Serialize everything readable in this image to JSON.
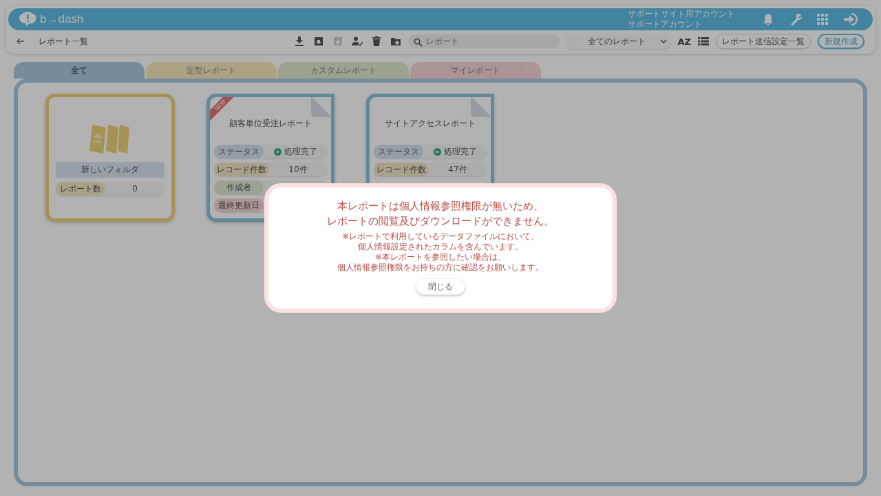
{
  "header": {
    "logo": "b→dash",
    "account_site": "サポートサイト用アカウント",
    "account_name": "サポートアカウント"
  },
  "toolbar": {
    "back_label": "レポート一覧",
    "tools": [
      {
        "kind": "download",
        "disabled": false
      },
      {
        "kind": "archive-down",
        "disabled": false
      },
      {
        "kind": "archive-up",
        "disabled": true
      },
      {
        "kind": "user-check",
        "disabled": false
      },
      {
        "kind": "trash",
        "disabled": false
      },
      {
        "kind": "folder-plus",
        "disabled": false
      }
    ],
    "search": {
      "placeholder": "レポート"
    },
    "filter": "全てのレポート",
    "sort_label": "AZ",
    "send_settings": "レポート送信設定一覧",
    "create": "新規作成"
  },
  "tabs": [
    {
      "label": "全て",
      "selected": true
    },
    {
      "label": "定型レポート",
      "selected": false
    },
    {
      "label": "カスタムレポート",
      "selected": false
    },
    {
      "label": "マイレポート",
      "selected": false
    }
  ],
  "cards": [
    {
      "kind": "folder",
      "title": "新しいフォルダ",
      "rows": [
        {
          "label": "レポート数",
          "value": "0",
          "kind": "plain"
        }
      ]
    },
    {
      "kind": "report",
      "new_badge": "NEW",
      "title": "顧客単位受注レポート",
      "rows": [
        {
          "label": "ステータス",
          "value": "処理完了",
          "kind": "status"
        },
        {
          "label": "レコード件数",
          "value": "10件",
          "kind": "plain"
        },
        {
          "label": "作成者",
          "kind": "creator"
        },
        {
          "label": "最終更新日",
          "kind": "updated"
        }
      ]
    },
    {
      "kind": "report",
      "title": "サイトアクセスレポート",
      "rows": [
        {
          "label": "ステータス",
          "value": "処理完了",
          "kind": "status"
        },
        {
          "label": "レコード件数",
          "value": "47件",
          "kind": "plain"
        }
      ]
    }
  ],
  "dialog": {
    "title_lines": [
      "本レポートは個人情報参照権限が無いため、",
      "レポートの閲覧及びダウンロードができません。"
    ],
    "body_lines": [
      "※レポートで利用しているデータファイルにおいて、",
      "個人情報設定されたカラムを含んでいます。",
      "※本レポートを参照したい場合は、",
      "個人情報参照権限をお持ちの方に確認をお願いします。"
    ],
    "close": "閉じる"
  }
}
